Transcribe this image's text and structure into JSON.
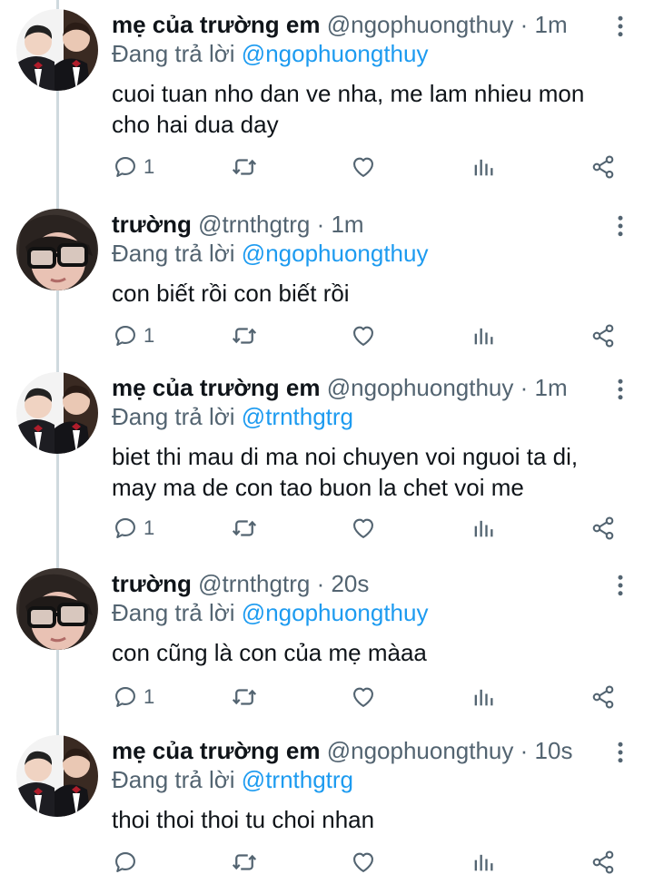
{
  "colors": {
    "accent": "#1d9bf0",
    "secondary_text": "#536471",
    "primary_text": "#0f1419",
    "thread_line": "#cfd9de"
  },
  "replying_prefix": "Đang trả lời",
  "tweets": [
    {
      "name": "mẹ của trường em",
      "handle": "@ngophuongthuy",
      "dot": "·",
      "time": "1m",
      "reply_to": "@ngophuongthuy",
      "lines": [
        "cuoi tuan nho dan ve nha, me lam nhieu mon",
        "cho hai dua day"
      ],
      "reply_count": "1",
      "avatar": "boys-photo-avatar"
    },
    {
      "name": "trường",
      "handle": "@trnthgtrg",
      "dot": "·",
      "time": "1m",
      "reply_to": "@ngophuongthuy",
      "lines": [
        "con biết rồi con biết rồi"
      ],
      "reply_count": "1",
      "avatar": "glasses-girl-avatar"
    },
    {
      "name": "mẹ của trường em",
      "handle": "@ngophuongthuy",
      "dot": "·",
      "time": "1m",
      "reply_to": "@trnthgtrg",
      "lines": [
        "biet thi mau di ma noi chuyen voi nguoi ta di,",
        "may ma de con tao buon la chet voi me"
      ],
      "reply_count": "1",
      "avatar": "boys-photo-avatar"
    },
    {
      "name": "trường",
      "handle": "@trnthgtrg",
      "dot": "·",
      "time": "20s",
      "reply_to": "@ngophuongthuy",
      "lines": [
        "con cũng là con của mẹ màaa"
      ],
      "reply_count": "1",
      "avatar": "glasses-girl-avatar"
    },
    {
      "name": "mẹ của trường em",
      "handle": "@ngophuongthuy",
      "dot": "·",
      "time": "10s",
      "reply_to": "@trnthgtrg",
      "lines": [
        "thoi thoi thoi tu choi nhan"
      ],
      "reply_count": "",
      "avatar": "boys-photo-avatar"
    }
  ],
  "action_icons": [
    "reply-icon",
    "retweet-icon",
    "like-icon",
    "views-icon",
    "share-icon"
  ]
}
